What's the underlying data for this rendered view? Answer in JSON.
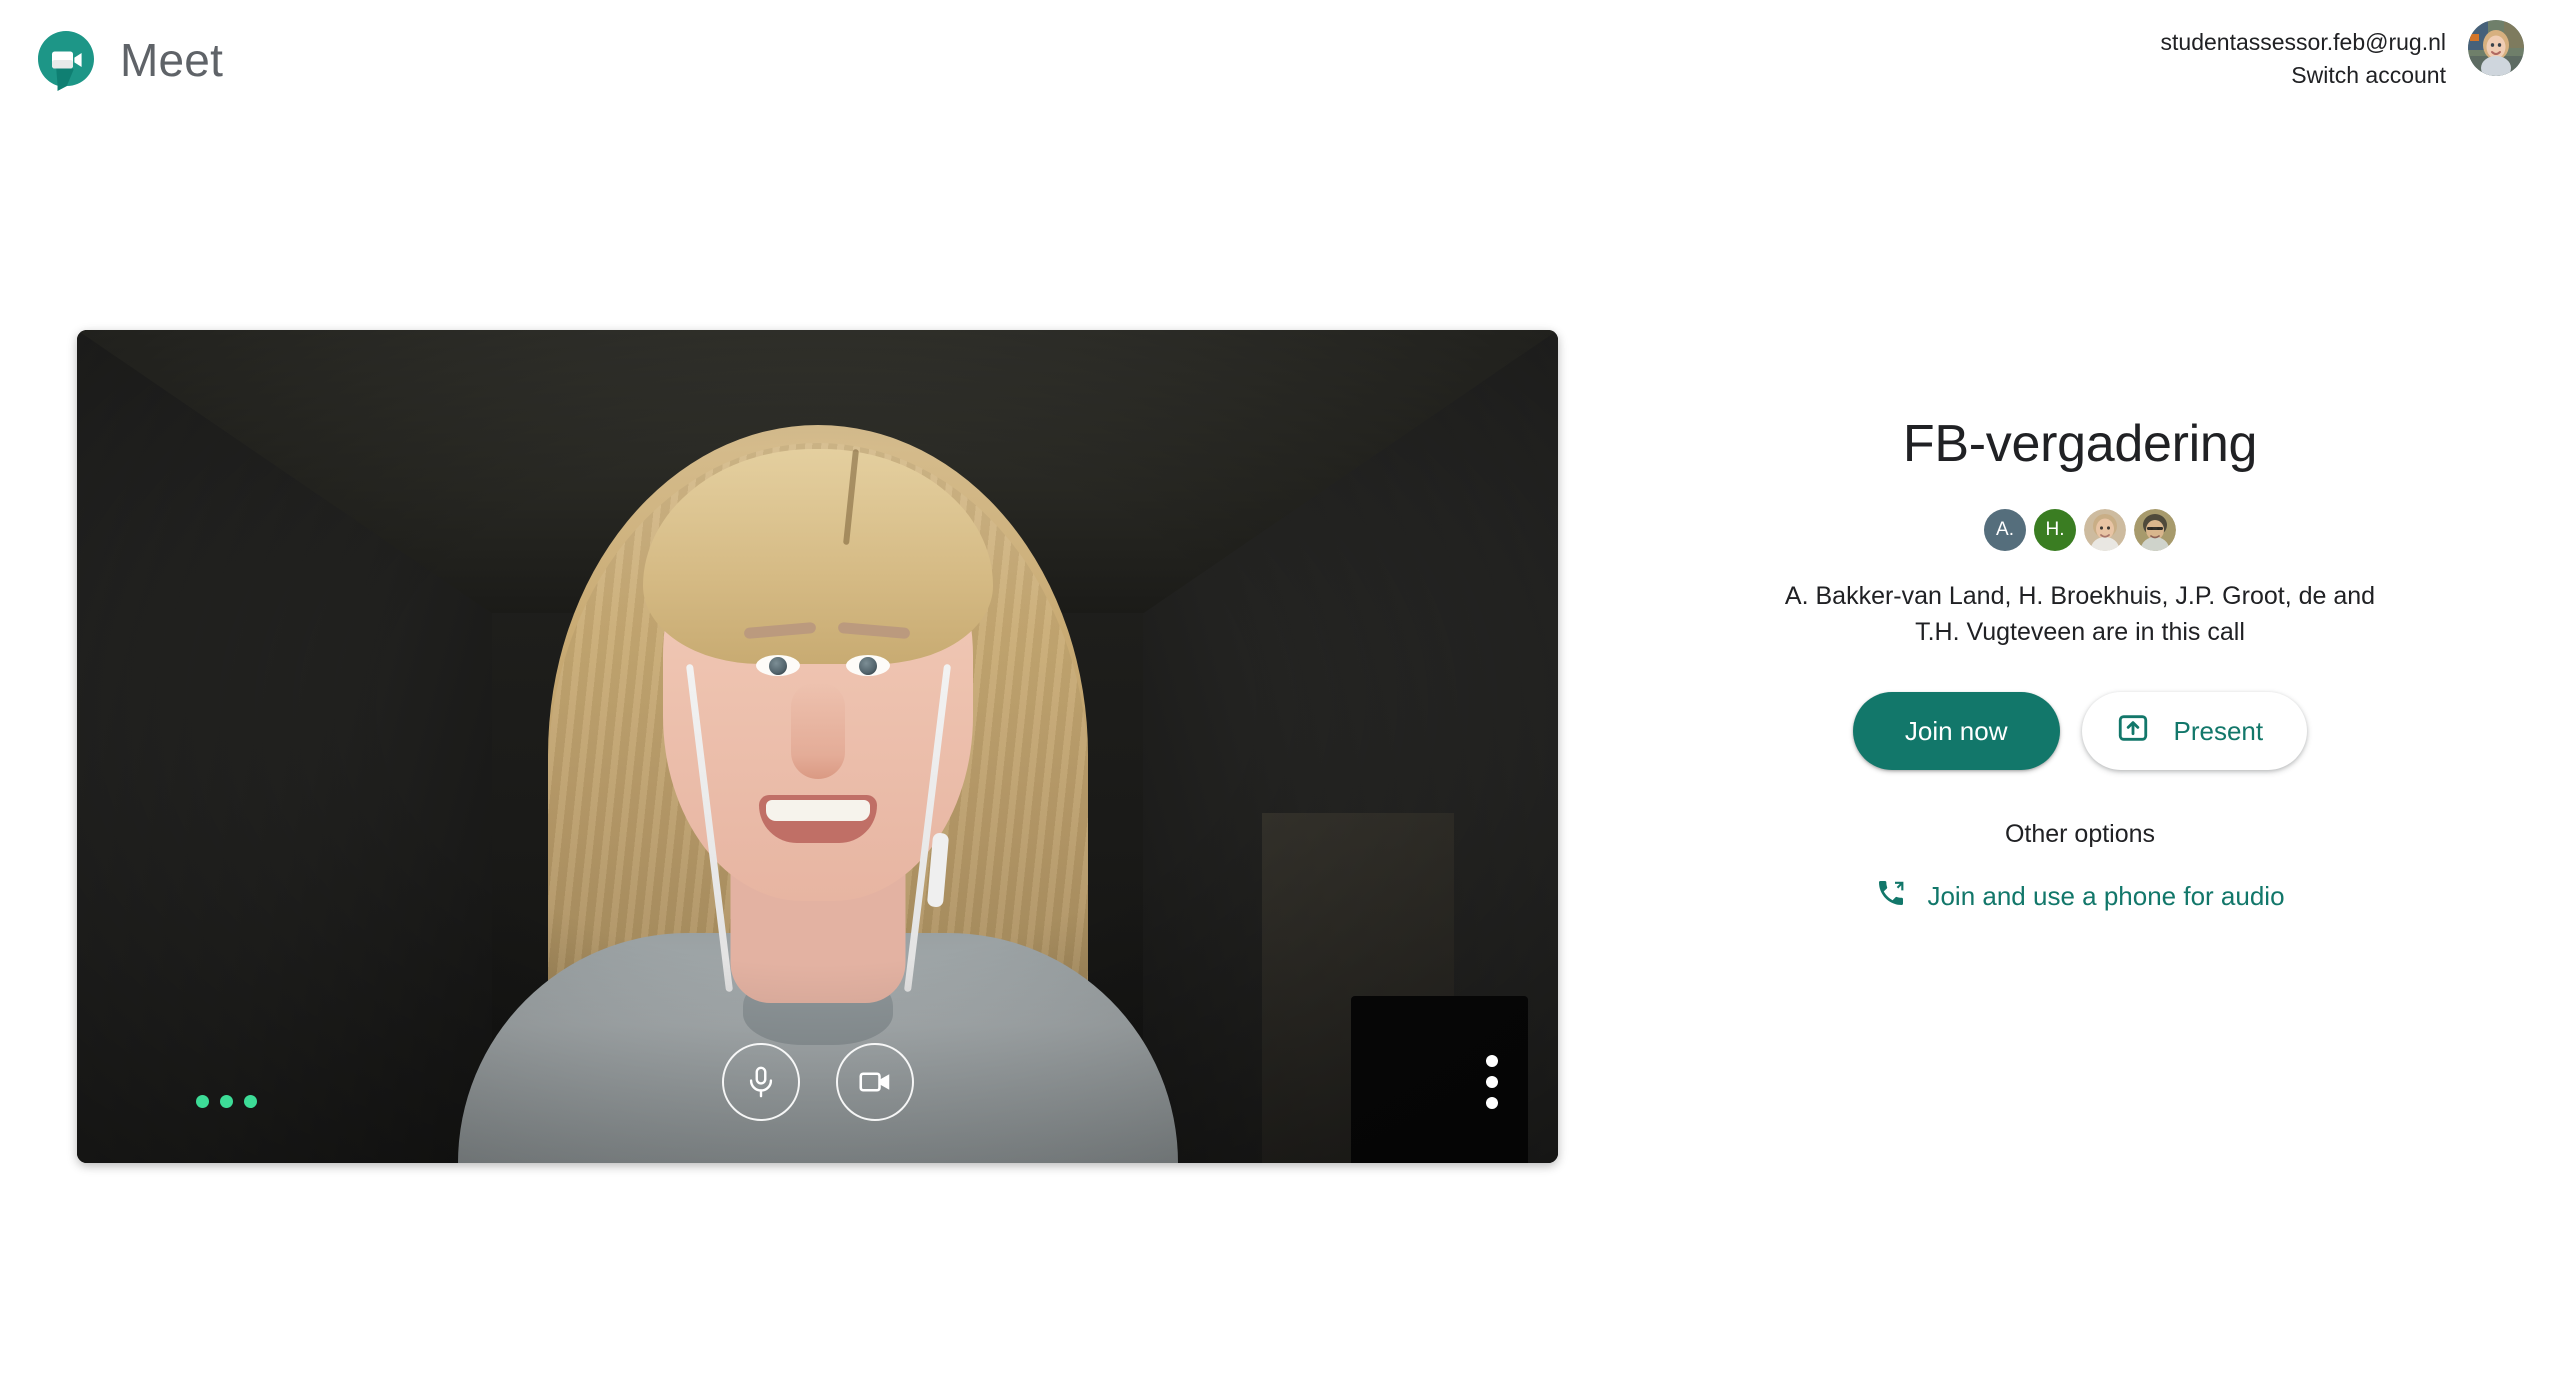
{
  "app": {
    "name": "Meet",
    "logo_icon": "meet-video-bubble-icon",
    "brand_color": "#00897B"
  },
  "header": {
    "account_email": "studentassessor.feb@rug.nl",
    "switch_account_label": "Switch account",
    "avatar_alt": "account-avatar"
  },
  "preview": {
    "mic_icon": "microphone-icon",
    "camera_icon": "video-camera-icon",
    "mic_level_icon": "mic-level-dots-icon",
    "more_icon": "more-options-vertical-icon"
  },
  "join": {
    "meeting_title": "FB-vergadering",
    "participants_text": "A. Bakker-van Land, H. Broekhuis, J.P. Groot, de and T.H. Vugteveen are in this call",
    "participants": [
      {
        "initials": "A.",
        "type": "initial",
        "color": "#556e7c"
      },
      {
        "initials": "H.",
        "type": "initial",
        "color": "#3a7d22"
      },
      {
        "initials": "",
        "type": "photo",
        "color": "#c7b49a"
      },
      {
        "initials": "",
        "type": "photo",
        "color": "#9c8f63"
      }
    ],
    "join_now_label": "Join now",
    "present_label": "Present",
    "present_icon": "present-screen-icon",
    "other_options_label": "Other options",
    "phone_audio_label": "Join and use a phone for audio",
    "phone_icon": "phone-forwarded-icon",
    "accent_color": "#12776a"
  }
}
